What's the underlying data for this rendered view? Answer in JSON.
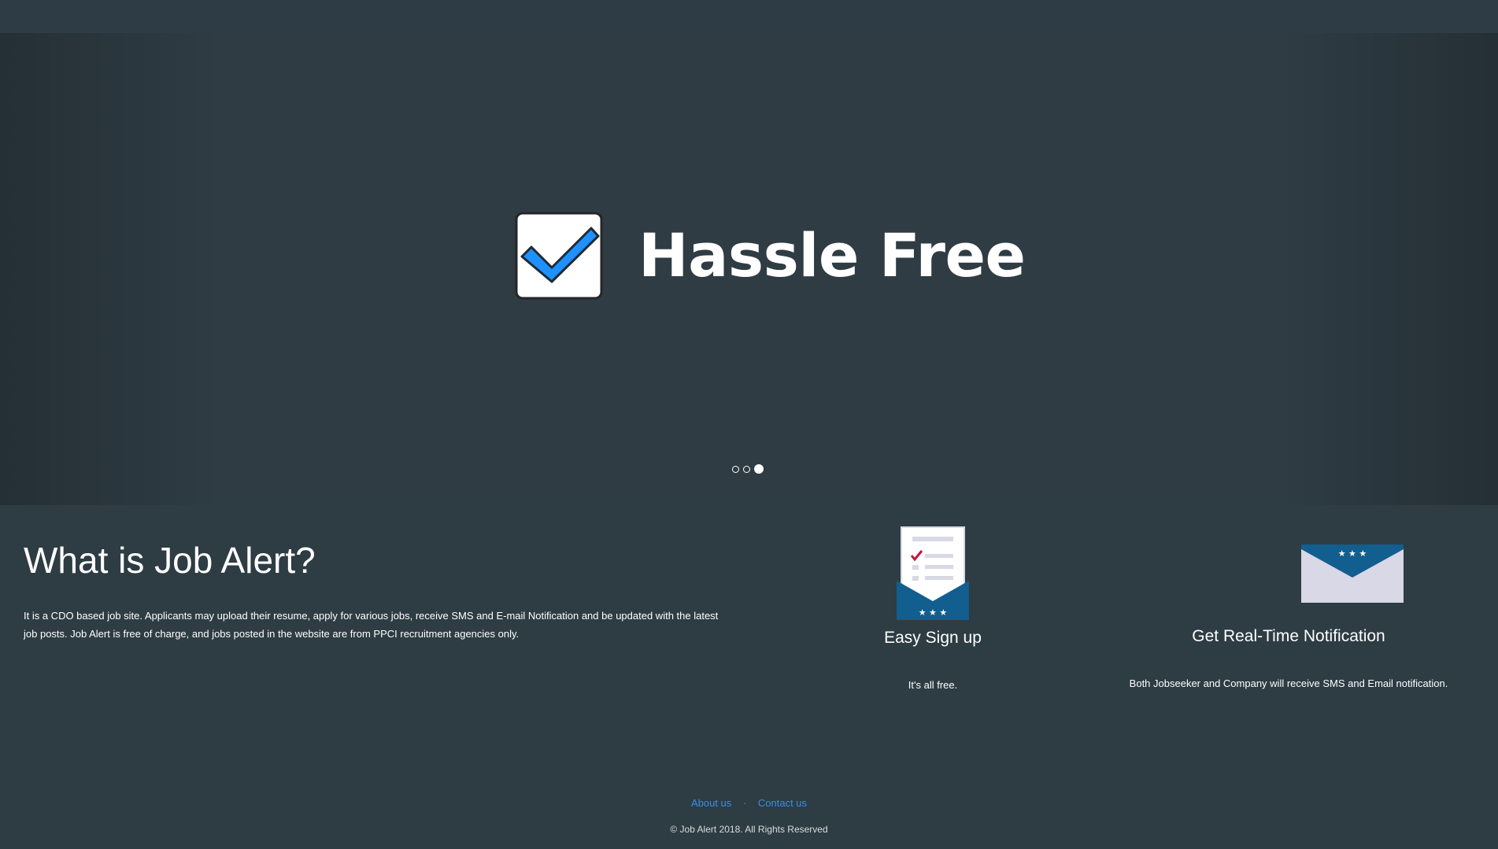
{
  "carousel": {
    "slide_title": "Hassle Free",
    "slide_icon": "checkbox-checked-icon",
    "indicator_count": 3,
    "active_indicator": 3
  },
  "about": {
    "heading": "What is Job Alert?",
    "text": "It is a CDO based job site. Applicants may upload their resume, apply for various jobs, receive SMS and E-mail Notification and be updated with the latest job posts. Job Alert is free of charge, and jobs posted in the website are from PPCI recruitment agencies only."
  },
  "features": [
    {
      "icon": "signup-form-envelope-icon",
      "title": "Easy Sign up",
      "description": "It's all free."
    },
    {
      "icon": "envelope-notification-icon",
      "title": "Get Real-Time Notification",
      "description": "Both Jobseeker and Company will receive SMS and Email notification."
    }
  ],
  "footer": {
    "links": [
      "About us",
      "Contact us"
    ],
    "separator": "·",
    "copyright": "© Job Alert 2018. All Rights Reserved"
  },
  "colors": {
    "background": "#2e3c44",
    "link": "#3b8fe0",
    "check_blue": "#1e90ff",
    "envelope_blue": "#125e8f",
    "envelope_light": "#d8d8e6",
    "checkmark_red": "#c0163e"
  }
}
